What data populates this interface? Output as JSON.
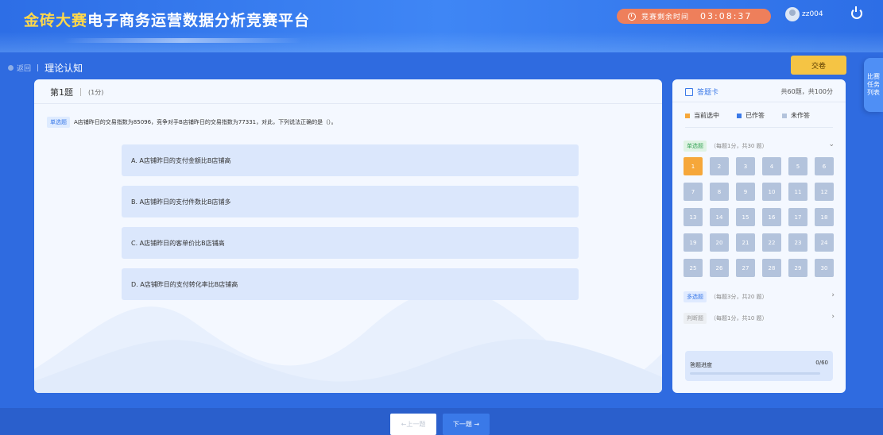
{
  "header": {
    "brand": "金砖大赛",
    "title": "电子商务运营数据分析竞赛平台",
    "timer_label": "竞赛剩余时间",
    "timer_value": "03:08:37",
    "username": "zz004"
  },
  "breadcrumb": {
    "back_label": "返回",
    "separator": "|",
    "page_title": "理论认知"
  },
  "submit_label": "交卷",
  "side_tab": [
    "比赛",
    "任务",
    "列表"
  ],
  "question": {
    "number_label": "第1题",
    "score_label": "(1分)",
    "type_tag": "单选题",
    "text": "A店铺昨日的交易指数为85096，竞争对手B店铺昨日的交易指数为77331，对此，下列说法正确的是（）。",
    "options": [
      "A. A店铺昨日的支付金额比B店铺高",
      "B. A店铺昨日的支付件数比B店铺多",
      "C. A店铺昨日的客单价比B店铺高",
      "D. A店铺昨日的支付转化率比B店铺高"
    ]
  },
  "answer_card": {
    "title": "答题卡",
    "total": "共60题，共100分",
    "legend": [
      {
        "label": "当前选中",
        "color": "#f6a73a"
      },
      {
        "label": "已作答",
        "color": "#3a79e8"
      },
      {
        "label": "未作答",
        "color": "#b3c3dc"
      }
    ],
    "sections": [
      {
        "tag": "单选题",
        "desc": "（每题1分，共30 题）",
        "chevron": "⌄",
        "tag_bg": "#dff3e4",
        "tag_color": "#3aa55a"
      },
      {
        "tag": "多选题",
        "desc": "（每题3分，共20 题）",
        "chevron": "›",
        "tag_bg": "#dfeaff",
        "tag_color": "#3a79e8"
      },
      {
        "tag": "判断题",
        "desc": "（每题1分，共10 题）",
        "chevron": "›",
        "tag_bg": "#eceff3",
        "tag_color": "#999999"
      }
    ],
    "numbers": [
      "1",
      "2",
      "3",
      "4",
      "5",
      "6",
      "7",
      "8",
      "9",
      "10",
      "11",
      "12",
      "13",
      "14",
      "15",
      "16",
      "17",
      "18",
      "19",
      "20",
      "21",
      "22",
      "23",
      "24",
      "25",
      "26",
      "27",
      "28",
      "29",
      "30"
    ],
    "current": "1",
    "progress_label": "答题进度",
    "progress_value": "0/60",
    "progress_fraction": 0
  },
  "nav": {
    "prev": "←上一题",
    "next": "下一题 →"
  }
}
